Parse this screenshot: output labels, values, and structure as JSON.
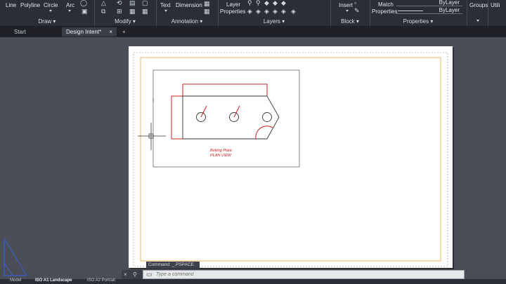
{
  "ribbon": {
    "draw": {
      "label": "Draw",
      "tools": [
        "Line",
        "Polyline",
        "Circle",
        "Arc"
      ]
    },
    "modify": {
      "label": "Modify"
    },
    "annotation": {
      "label": "Annotation",
      "tools": [
        "Text",
        "Dimension"
      ]
    },
    "layers": {
      "label": "Layers",
      "layer_properties_line1": "Layer",
      "layer_properties_line2": "Properties"
    },
    "block": {
      "label": "Block",
      "insert": "Insert"
    },
    "properties": {
      "label": "Properties",
      "match_line1": "Match",
      "match_line2": "Properties",
      "bylayer_1": "ByLayer",
      "bylayer_2": "ByLayer"
    },
    "groups": {
      "label": "Groups"
    },
    "utilities": {
      "label": "Utili"
    }
  },
  "tabs": [
    {
      "label": "Start",
      "active": false
    },
    {
      "label": "Design Intent*",
      "active": true,
      "close": "×"
    },
    {
      "label": "+",
      "active": false
    }
  ],
  "drawing": {
    "title_line1": "Bolting Plate",
    "title_line2": "PLAN VIEW"
  },
  "command": {
    "history": "Command: _.PSPACE",
    "placeholder": "Type a command"
  },
  "status": {
    "model_tab": "Model",
    "layout1_tab": "ISO A1 Landscape",
    "layout2_tab": "ISO A2 Portrait"
  },
  "colors": {
    "ribbon_bg": "#2b2e36",
    "viewport_bg": "#4b4e56",
    "paper": "#ffffff",
    "margin_line": "#f0a23a",
    "drawing_red": "#d21f1f",
    "ucs_blue": "#3a5fd0"
  }
}
